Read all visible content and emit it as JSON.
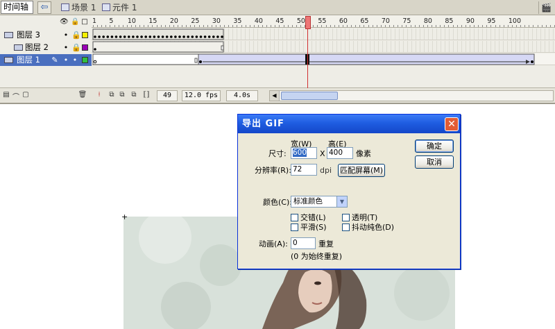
{
  "topbar": {
    "timeline_tab": "时间轴",
    "scene_label": "场景 1",
    "symbol_label": "元件 1",
    "back_icon": "back-arrow-icon",
    "clapper_icon": "edit-scene-icon"
  },
  "timeline": {
    "header_icons": [
      "eye-icon",
      "lock-icon",
      "outline-icon"
    ],
    "ruler_labels": [
      "1",
      "5",
      "10",
      "15",
      "20",
      "25",
      "30",
      "35",
      "40",
      "45",
      "50",
      "55",
      "60",
      "65",
      "70",
      "75",
      "80",
      "85",
      "90",
      "95",
      "100"
    ],
    "layers": [
      {
        "name": "图层 3",
        "eye": "•",
        "lock": "🔒",
        "color": "#f5f000",
        "selected": false
      },
      {
        "name": "图层 2",
        "eye": "•",
        "lock": "🔒",
        "color": "#9a00b5",
        "selected": false
      },
      {
        "name": "图层 1",
        "eye": "•",
        "lock": "•",
        "color": "#30c040",
        "selected": true,
        "pencil": "✎"
      }
    ],
    "current_frame": "49",
    "frame_rate": "12.0 fps",
    "elapsed": "4.0s",
    "colors": {
      "selected_row": "#4a6fbf",
      "tween_fill": "#d6d8f5",
      "playhead": "#e06060"
    }
  },
  "dialog": {
    "title": "导出 GIF",
    "close_icon": "close-icon",
    "width_label": "宽(W)",
    "height_label": "高(E)",
    "size_label": "尺寸:",
    "width_value": "600",
    "x_sep": "X",
    "height_value": "400",
    "pixel_unit": "像素",
    "resolution_label": "分辨率(R):",
    "resolution_value": "72",
    "dpi_unit": "dpi",
    "match_screen_button": "匹配屏幕(M)",
    "ok_button": "确定",
    "cancel_button": "取消",
    "colors_label": "颜色(C):",
    "colors_value": "标准颜色",
    "interlace_label": "交错(L)",
    "transparent_label": "透明(T)",
    "smooth_label": "平滑(S)",
    "dither_label": "抖动纯色(D)",
    "animation_label": "动画(A):",
    "animation_value": "0",
    "repeat_label": "重复",
    "repeat_hint": "(0 为始终重复)"
  }
}
